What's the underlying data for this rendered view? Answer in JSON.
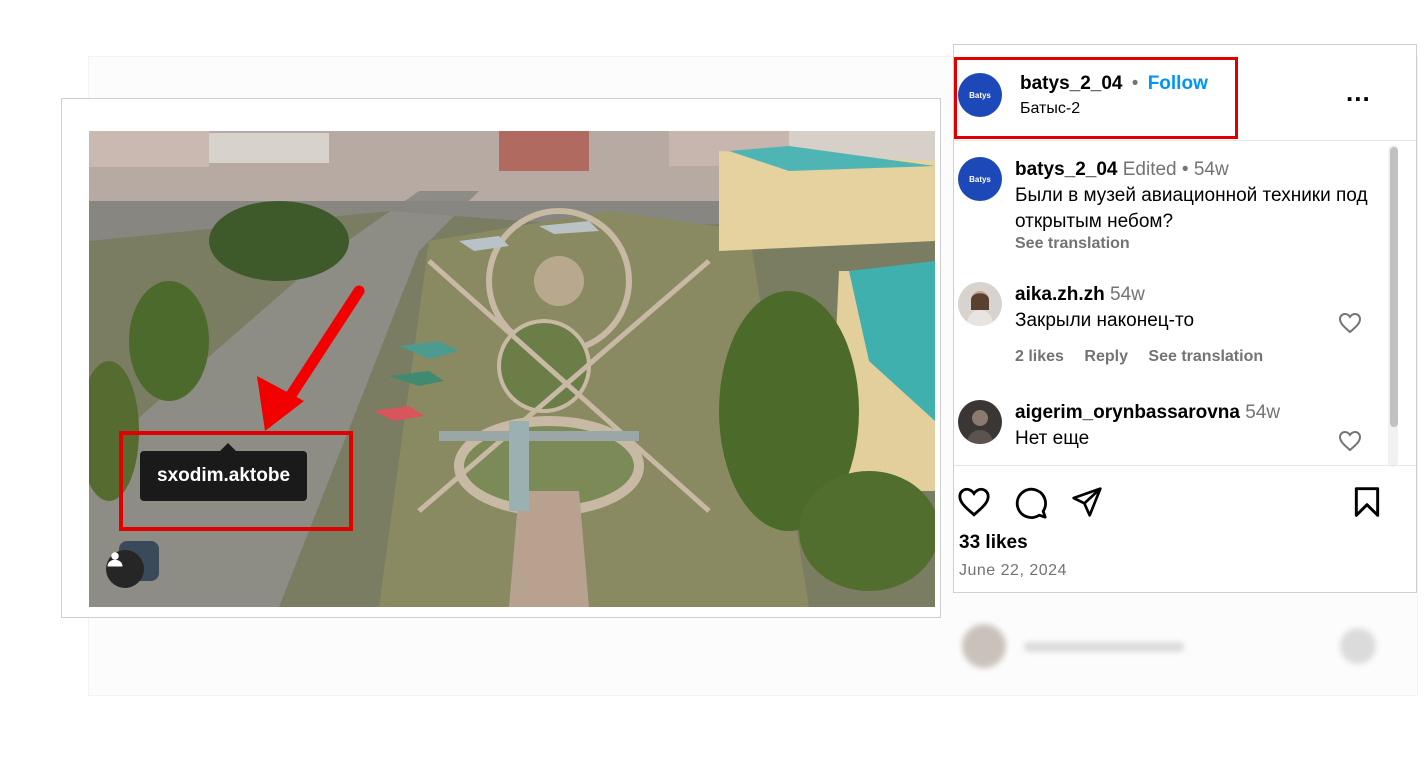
{
  "photo": {
    "tag_label": "sxodim.aktobe"
  },
  "header": {
    "avatar_text": "Batys",
    "username": "batys_2_04",
    "separator": "•",
    "follow_label": "Follow",
    "location": "Батыс-2",
    "more_label": "..."
  },
  "comments": [
    {
      "username": "batys_2_04",
      "meta": "Edited • 54w",
      "text": "Были в музей авиационной техники под открытым небом?",
      "translation": "See translation"
    },
    {
      "username": "aika.zh.zh",
      "meta": "54w",
      "text": "Закрыли наконец-то",
      "likes": "2 likes",
      "reply": "Reply",
      "translation": "See translation"
    },
    {
      "username": "aigerim_orynbassarovna",
      "meta": "54w",
      "text": "Нет еще"
    }
  ],
  "post": {
    "likes": "33 likes",
    "date": "June 22, 2024"
  },
  "colors": {
    "accent": "#0095f6",
    "highlight": "#e00000",
    "avatar": "#1c48b8"
  }
}
